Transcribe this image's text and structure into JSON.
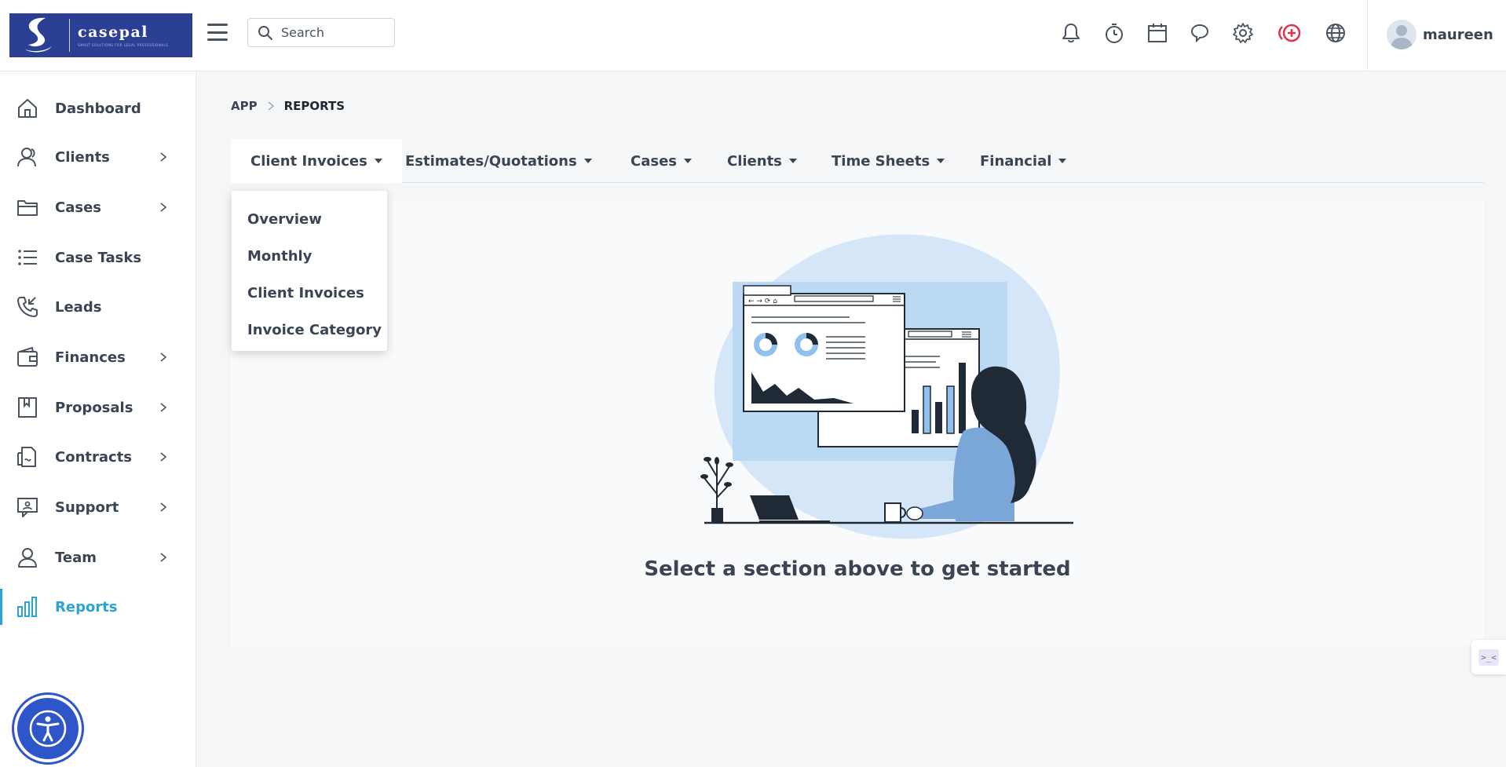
{
  "brand": {
    "name": "casepal",
    "tagline": "SMART SOLUTIONS FOR LEGAL PROFESSIONALS",
    "color": "#2b3f94"
  },
  "search": {
    "placeholder": "Search"
  },
  "header_icons": [
    "bell-icon",
    "timer-icon",
    "calendar-icon",
    "chat-icon",
    "gear-icon",
    "add-circle-icon",
    "globe-icon"
  ],
  "user": {
    "name": "maureen"
  },
  "sidebar": {
    "items": [
      {
        "label": "Dashboard",
        "icon": "home-icon",
        "has_children": false
      },
      {
        "label": "Clients",
        "icon": "clients-icon",
        "has_children": true
      },
      {
        "label": "Cases",
        "icon": "folder-icon",
        "has_children": true
      },
      {
        "label": "Case Tasks",
        "icon": "list-icon",
        "has_children": false
      },
      {
        "label": "Leads",
        "icon": "phone-icon",
        "has_children": false
      },
      {
        "label": "Finances",
        "icon": "wallet-icon",
        "has_children": true
      },
      {
        "label": "Proposals",
        "icon": "book-icon",
        "has_children": true
      },
      {
        "label": "Contracts",
        "icon": "contract-icon",
        "has_children": true
      },
      {
        "label": "Support",
        "icon": "support-icon",
        "has_children": true
      },
      {
        "label": "Team",
        "icon": "user-icon",
        "has_children": true
      },
      {
        "label": "Reports",
        "icon": "bar-chart-icon",
        "has_children": false,
        "active": true
      }
    ]
  },
  "breadcrumb": {
    "root": "APP",
    "current": "REPORTS"
  },
  "tabs": [
    {
      "label": "Client Invoices",
      "active": true
    },
    {
      "label": "Estimates/Quotations"
    },
    {
      "label": "Cases"
    },
    {
      "label": "Clients"
    },
    {
      "label": "Time Sheets"
    },
    {
      "label": "Financial"
    }
  ],
  "dropdown": {
    "items": [
      "Overview",
      "Monthly",
      "Client Invoices",
      "Invoice Category"
    ]
  },
  "empty_state": {
    "message": "Select a section above to get started"
  },
  "side_widget": {
    "label": ">_<"
  },
  "colors": {
    "accent": "#2aa3d6",
    "alert": "#e0334d",
    "text": "#3b4452"
  }
}
